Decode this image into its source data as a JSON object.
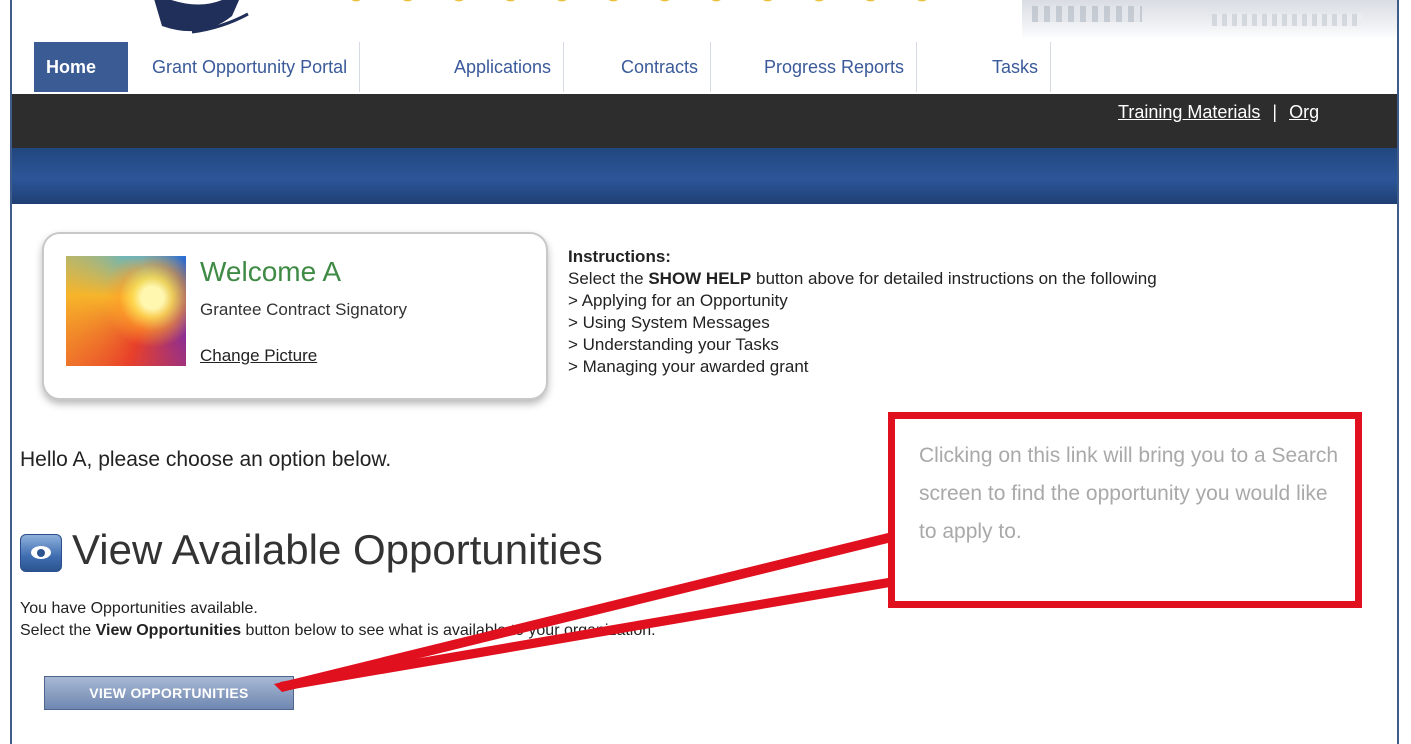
{
  "nav": {
    "tabs": [
      {
        "label": "Home",
        "active": true
      },
      {
        "label": "Grant Opportunity Portal",
        "active": false
      },
      {
        "label": "Applications",
        "active": false
      },
      {
        "label": "Contracts",
        "active": false
      },
      {
        "label": "Progress Reports",
        "active": false
      },
      {
        "label": "Tasks",
        "active": false
      }
    ],
    "utility_links": [
      "Training Materials",
      "Org"
    ],
    "separator": "|"
  },
  "welcome": {
    "greeting": "Welcome A",
    "role": "Grantee Contract Signatory",
    "change_picture": "Change Picture"
  },
  "instructions": {
    "heading": "Instructions:",
    "intro_before": "Select the ",
    "intro_bold": "SHOW HELP",
    "intro_after": " button above for detailed instructions on the following",
    "items": [
      "> Applying for an Opportunity",
      "> Using System Messages",
      "> Understanding your Tasks",
      "> Managing your awarded grant"
    ]
  },
  "hello_text": "Hello A, please choose an option below.",
  "opportunities": {
    "title": "View Available Opportunities",
    "line1": "You have Opportunities available.",
    "line2_before": "Select the ",
    "line2_bold": "View Opportunities",
    "line2_after": " button below to see what is available to your organization.",
    "button_label": "VIEW OPPORTUNITIES"
  },
  "callout": {
    "text": "Clicking on this link will bring you to a Search screen to find the opportunity you would like to apply to."
  },
  "colors": {
    "tab_active": "#3b5b94",
    "dark_bar": "#2d2d2d",
    "blue_bar": "#2c5699",
    "welcome_green": "#3f8a44",
    "callout_red": "#e0101e"
  }
}
